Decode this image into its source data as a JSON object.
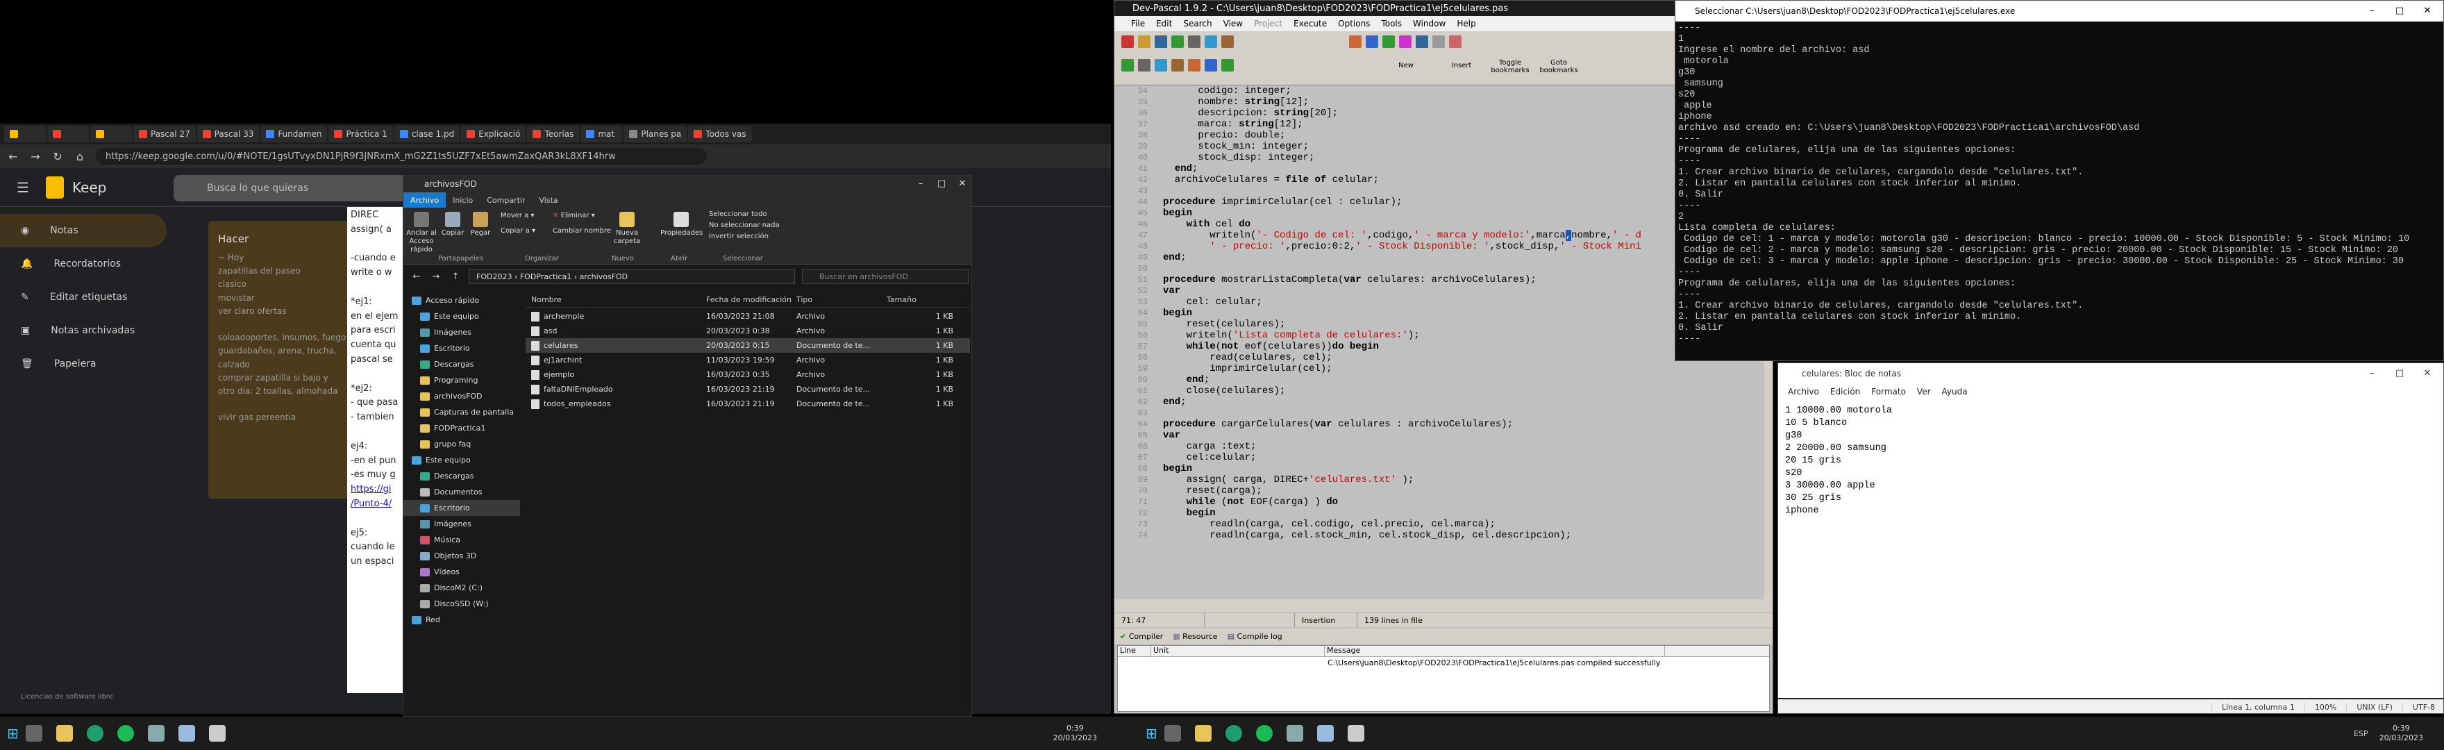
{
  "browser": {
    "tabs": [
      {
        "label": "",
        "color": "#fbbc04"
      },
      {
        "label": "",
        "color": "#ea4335"
      },
      {
        "label": "",
        "color": "#fbbc04"
      },
      {
        "label": "Pascal 27",
        "color": "#ea4335"
      },
      {
        "label": "Pascal 33",
        "color": "#ea4335"
      },
      {
        "label": "Fundamen",
        "color": "#4285f4"
      },
      {
        "label": "Práctica 1",
        "color": "#ea4335"
      },
      {
        "label": "clase 1.pd",
        "color": "#4285f4"
      },
      {
        "label": "Explicació",
        "color": "#ea4335"
      },
      {
        "label": "Teorías",
        "color": "#ea4335"
      },
      {
        "label": "mat",
        "color": "#4285f4"
      },
      {
        "label": "Planes pa",
        "color": "#888888"
      },
      {
        "label": "Todos vas",
        "color": "#ea4335"
      }
    ],
    "url": "https://keep.google.com/u/0/#NOTE/1gsUTvyxDN1PjR9f3JNRxmX_mG2Z1ts5UZF7xEt5awmZaxQAR3kL8XF14hrw",
    "keep_title": "Keep",
    "search_placeholder": "Busca lo que quieras",
    "nav": [
      "Notas",
      "Recordatorios",
      "Editar etiquetas",
      "Notas archivadas",
      "Papelera"
    ],
    "note_title": "Hacer",
    "note_lines": [
      "~ Hoy",
      "zapatillas del paseo",
      "clasico",
      "movistar",
      "ver claro ofertas",
      "",
      "soloadoportes, insumos, fuego",
      "guardabaños, arena, trucha, calzado",
      "comprar zapatilla si bajo y",
      "otro día: 2 toallas, almohada",
      "",
      "vivir gas pereentia"
    ],
    "doc_lines": [
      "DIREC",
      "assign( a",
      "",
      "-cuando e",
      "write o w",
      "",
      "*ej1:",
      "en el ejem",
      "para escri",
      "cuenta qu",
      "pascal se",
      "",
      "*ej2:",
      "- que pasa",
      "- tambien",
      "",
      "ej4:",
      "-en el pun",
      "-es muy g",
      "https://gi",
      "/Punto-4/",
      "",
      "ej5:",
      "cuando le",
      "un espaci"
    ],
    "footer": "Licencias de software libre"
  },
  "explorer": {
    "title": "archivosFOD",
    "ribbon_tabs": [
      "Archivo",
      "Inicio",
      "Compartir",
      "Vista"
    ],
    "ribbon_buttons": {
      "anclar": "Anclar al Acceso rápido",
      "copiar": "Copiar",
      "pegar": "Pegar",
      "mover": "Mover a",
      "copiar_a": "Copiar a",
      "eliminar": "Eliminar",
      "cambiar": "Cambiar nombre",
      "nueva": "Nueva carpeta",
      "propiedades": "Propiedades",
      "sel_todo": "Seleccionar todo",
      "no_sel": "No seleccionar nada",
      "invertir": "Invertir selección"
    },
    "groups": [
      "Portapapeles",
      "Organizar",
      "Nuevo",
      "Abrir",
      "Seleccionar"
    ],
    "path": "FOD2023  ›  FODPractica1  ›  archivosFOD",
    "search": "Buscar en archivosFOD",
    "sidebar": [
      "Acceso rápido",
      "Este equipo",
      "Imágenes",
      "Escritorio",
      "Descargas",
      "Programing",
      "archivosFOD",
      "Capturas de pantalla",
      "FODPractica1",
      "grupo faq",
      "Este equipo",
      "Descargas",
      "Documentos",
      "Escritorio",
      "Imágenes",
      "Música",
      "Objetos 3D",
      "Vídeos",
      "DiscoM2 (C:)",
      "DiscoSSD (W:)",
      "Red"
    ],
    "columns": [
      "Nombre",
      "Fecha de modificación",
      "Tipo",
      "Tamaño"
    ],
    "files": [
      {
        "name": "archemple",
        "date": "16/03/2023 21:08",
        "type": "Archivo",
        "size": "1 KB"
      },
      {
        "name": "asd",
        "date": "20/03/2023 0:38",
        "type": "Archivo",
        "size": "1 KB"
      },
      {
        "name": "celulares",
        "date": "20/03/2023 0:15",
        "type": "Documento de te...",
        "size": "1 KB"
      },
      {
        "name": "ej1archint",
        "date": "11/03/2023 19:59",
        "type": "Archivo",
        "size": "1 KB"
      },
      {
        "name": "ejemplo",
        "date": "16/03/2023 0:35",
        "type": "Archivo",
        "size": "1 KB"
      },
      {
        "name": "faltaDNIEmpleado",
        "date": "16/03/2023 21:19",
        "type": "Documento de te...",
        "size": "1 KB"
      },
      {
        "name": "todos_empleados",
        "date": "16/03/2023 21:19",
        "type": "Documento de te...",
        "size": "1 KB"
      }
    ]
  },
  "devpascal": {
    "title": "Dev-Pascal 1.9.2 - C:\\Users\\juan8\\Desktop\\FOD2023\\FODPractica1\\ej5celulares.pas",
    "menu": [
      "File",
      "Edit",
      "Search",
      "View",
      "Project",
      "Execute",
      "Options",
      "Tools",
      "Window",
      "Help"
    ],
    "toolbar_text": [
      "New",
      "Insert",
      "Toggle bookmarks",
      "Goto bookmarks"
    ],
    "status": [
      "71: 47",
      "",
      "Insertion",
      "139 lines in file"
    ],
    "bottom_tabs": [
      "Compiler",
      "Resource",
      "Compile log"
    ],
    "msg_cols": [
      "Line",
      "Unit",
      "Message"
    ],
    "message": "C:\\Users\\juan8\\Desktop\\FOD2023\\FODPractica1\\ej5celulares.pas compiled successfully"
  },
  "cmd": {
    "title": "Seleccionar C:\\Users\\juan8\\Desktop\\FOD2023\\FODPractica1\\ej5celulares.exe",
    "lines": [
      "----",
      "1",
      "Ingrese el nombre del archivo: asd",
      " motorola",
      "g30",
      " samsung",
      "s20",
      " apple",
      "iphone",
      "archivo asd creado en: C:\\Users\\juan8\\Desktop\\FOD2023\\FODPractica1\\archivosFOD\\asd",
      "----",
      "Programa de celulares, elija una de las siguientes opciones:",
      "----",
      "1. Crear archivo binario de celulares, cargandolo desde \"celulares.txt\".",
      "2. Listar en pantalla celulares con stock inferior al minimo.",
      "0. Salir",
      "----",
      "2",
      "Lista completa de celulares:",
      " Codigo de cel: 1 - marca y modelo: motorola g30 - descripcion: blanco - precio: 10000.00 - Stock Disponible: 5 - Stock Minimo: 10",
      " Codigo de cel: 2 - marca y modelo: samsung s20 - descripcion: gris - precio: 20000.00 - Stock Disponible: 15 - Stock Minimo: 20",
      " Codigo de cel: 3 - marca y modelo: apple iphone - descripcion: gris - precio: 30000.00 - Stock Disponible: 25 - Stock Minimo: 30",
      "----",
      "Programa de celulares, elija una de las siguientes opciones:",
      "----",
      "1. Crear archivo binario de celulares, cargandolo desde \"celulares.txt\".",
      "2. Listar en pantalla celulares con stock inferior al minimo.",
      "0. Salir",
      "----"
    ]
  },
  "notepad": {
    "title": "celulares: Bloc de notas",
    "menu": [
      "Archivo",
      "Edición",
      "Formato",
      "Ver",
      "Ayuda"
    ],
    "lines": [
      "1 10000.00 motorola",
      "10 5 blanco",
      "g30",
      "2 20000.00 samsung",
      "20 15 gris",
      "s20",
      "3 30000.00 apple",
      "30 25 gris",
      "iphone"
    ],
    "status": [
      "Línea 1, columna 1",
      "100%",
      "UNIX (LF)",
      "UTF-8"
    ]
  },
  "taskbar": {
    "left_time": "0:39",
    "left_date": "20/03/2023",
    "right_time": "0:39",
    "right_date": "20/03/2023",
    "lang": "ESP"
  }
}
